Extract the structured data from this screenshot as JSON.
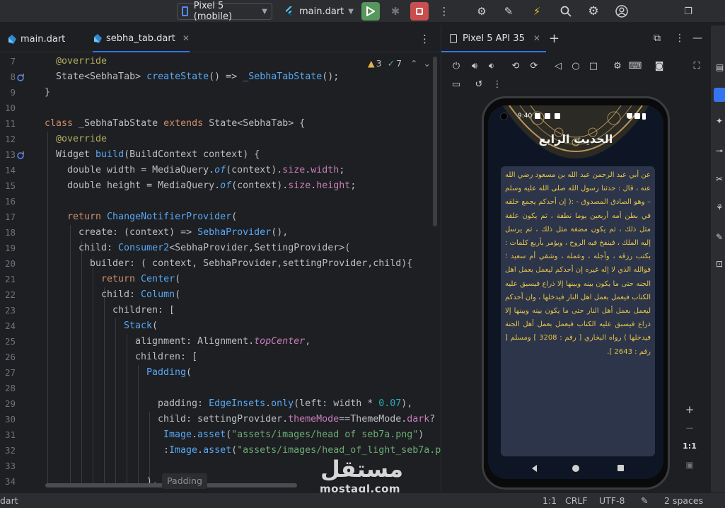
{
  "toolbar": {
    "device_label": "Pixel 5 (mobile)",
    "config_label": "main.dart",
    "icons": [
      "play-icon",
      "bug-icon",
      "stop-icon",
      "more-icon",
      "attach-debugger-icon",
      "edit-file-icon",
      "hot-reload-icon",
      "search-icon",
      "gear-icon",
      "account-icon",
      "window-icon"
    ]
  },
  "editor": {
    "tabs": [
      {
        "label": "main.dart",
        "active": false
      },
      {
        "label": "sebha_tab.dart",
        "active": true
      }
    ],
    "inspections": {
      "warnings": "3",
      "weak_warnings": "7"
    },
    "lines": [
      {
        "n": "7"
      },
      {
        "n": "8"
      },
      {
        "n": "9"
      },
      {
        "n": "10"
      },
      {
        "n": "11"
      },
      {
        "n": "12"
      },
      {
        "n": "13"
      },
      {
        "n": "14"
      },
      {
        "n": "15"
      },
      {
        "n": "16"
      },
      {
        "n": "17"
      },
      {
        "n": "18"
      },
      {
        "n": "19"
      },
      {
        "n": "20"
      },
      {
        "n": "21"
      },
      {
        "n": "22"
      },
      {
        "n": "23"
      },
      {
        "n": "24"
      },
      {
        "n": "25"
      },
      {
        "n": "26"
      },
      {
        "n": "27"
      },
      {
        "n": "28"
      },
      {
        "n": "29"
      },
      {
        "n": "30"
      },
      {
        "n": "31"
      },
      {
        "n": "32"
      },
      {
        "n": "33"
      },
      {
        "n": "34"
      }
    ],
    "code": {
      "l7": "@override",
      "l8a": "State<SebhaTab> ",
      "l8b": "createState",
      "l8c": "() => ",
      "l8d": "_SebhaTabState",
      "l8e": "();",
      "l9": "}",
      "l11a": "class ",
      "l11b": "_SebhaTabState ",
      "l11c": "extends ",
      "l11d": "State<SebhaTab> {",
      "l12": "@override",
      "l13a": "Widget ",
      "l13b": "build",
      "l13c": "(BuildContext context) {",
      "l14a": "double ",
      "l14b": "width = MediaQuery.",
      "l14c": "of",
      "l14d": "(context).",
      "l14e": "size",
      "l14f": ".",
      "l14g": "width",
      "l14h": ";",
      "l15a": "double ",
      "l15b": "height = MediaQuery.",
      "l15c": "of",
      "l15d": "(context).",
      "l15e": "size",
      "l15f": ".",
      "l15g": "height",
      "l15h": ";",
      "l17a": "return ",
      "l17b": "ChangeNotifierProvider",
      "l17c": "(",
      "l18a": "create: (context) => ",
      "l18b": "SebhaProvider",
      "l18c": "(),",
      "l19a": "child: ",
      "l19b": "Consumer2",
      "l19c": "<SebhaProvider,SettingProvider>(",
      "l20a": "builder: ( context, ",
      "l20b": "SebhaProvider",
      "l20c": ",settingProvider,child){",
      "l21a": "return ",
      "l21b": "Center",
      "l21c": "(",
      "l22a": "child: ",
      "l22b": "Column",
      "l22c": "(",
      "l23": "children: [",
      "l24a": "Stack",
      "l24b": "(",
      "l25a": "alignment: Alignment.",
      "l25b": "topCenter",
      "l25c": ",",
      "l26": "children: [",
      "l27a": "Padding",
      "l27b": "(",
      "l29a": "padding: ",
      "l29b": "EdgeInsets",
      "l29c": ".",
      "l29d": "only",
      "l29e": "(left: width * ",
      "l29f": "0.07",
      "l29g": "),",
      "l30a": "child: settingProvider.",
      "l30b": "themeMode",
      "l30c": "==ThemeMode.",
      "l30d": "dark",
      "l30e": "?",
      "l31a": "Image",
      "l31b": ".",
      "l31c": "asset",
      "l31d": "(",
      "l31e": "\"assets/images/head of seb7a.png\"",
      "l31f": ")",
      "l32a": ":",
      "l32b": "Image",
      "l32c": ".",
      "l32d": "asset",
      "l32e": "(",
      "l32f": "\"assets/images/head_of_light_seb7a.p",
      "l34": "),"
    },
    "hint_chip": "Padding"
  },
  "emulator": {
    "tab_label": "Pixel 5 API 35",
    "phone": {
      "time": "9:40",
      "title": "الحديث الرابع",
      "hadith": "عن أبي عبد الرحمن عبد الله بن مسعود رضي الله عنه ، قال : حدثنا رسول الله صلى الله عليه وسلم – وهو الصادق المصدوق - :( إن أحدكم يجمع خلقه في بطن أمه أربعين يوما نطفة ، ثم يكون علقة مثل ذلك ، ثم يكون مضغة مثل ذلك ، ثم يرسل إليه الملك ، فينفخ فيه الروح ، ويؤمر بأربع كلمات : بكتب رزقه ، وأجله ، وعمله ، وشقي أم سعيد ؛ فوالله الذي لا إله غيره إن أحدكم ليعمل بعمل اهل الجنه حتى ما يكون بينه وبينها إلا ذراع فيسبق عليه الكتاب فيعمل بعمل اهل النار فيدخلها ، وان أحدكم ليعمل بعمل أهل النار حتى ما يكون بينه وبينها إلا ذراع فيسبق عليه الكتاب فيعمل بعمل أهل الجنة فيدخلها ) رواه البخاري [ رقم : 3208 ] ومسلم [ رقم : 2643 ]."
    },
    "zoom": {
      "plus": "+",
      "minus": "−",
      "ratio": "1:1"
    }
  },
  "watermark": {
    "arabic": "مستقل",
    "latin": "mostaql.com"
  },
  "statusbar": {
    "left": "dart",
    "position": "1:1",
    "line_sep": "CRLF",
    "encoding": "UTF-8",
    "indent": "2 spaces"
  },
  "colors": {
    "run": "#57965c",
    "stop": "#c94f4f",
    "accent": "#3574f0",
    "hadith_text": "#e7c44a",
    "card": "#2c3549"
  }
}
